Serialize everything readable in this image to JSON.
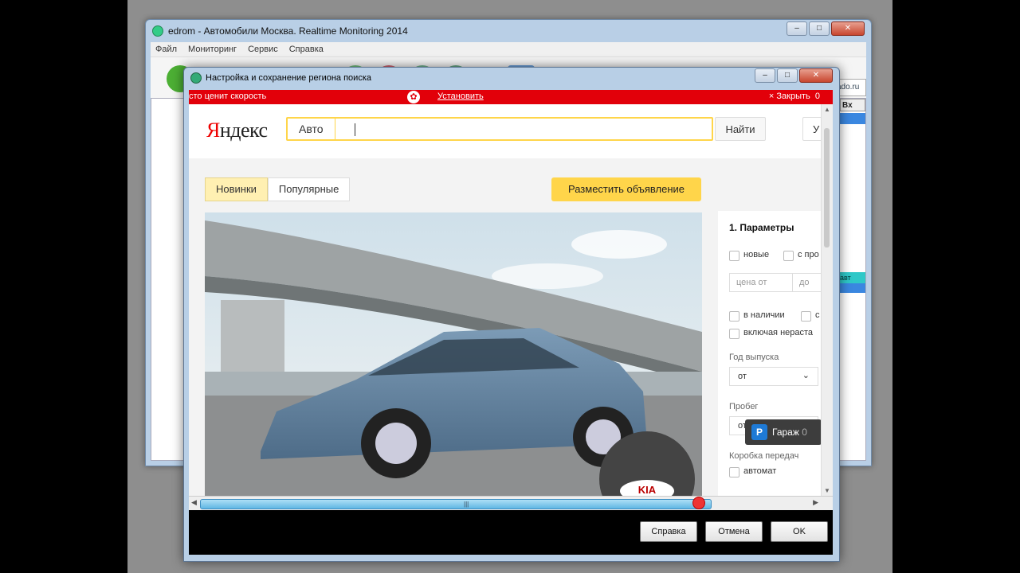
{
  "bg_window": {
    "title": "edrom - Автомобили Москва. Realtime Monitoring 2014",
    "menu": [
      "Файл",
      "Мониторинг",
      "Сервис",
      "Справка"
    ],
    "side_label": "ado.ru",
    "col_label": "Вх",
    "cell_label": "авт"
  },
  "dialog": {
    "title": "Настройка и сохранение региона поиска",
    "buttons": {
      "help": "Справка",
      "cancel": "Отмена",
      "ok": "OK"
    }
  },
  "promo_bar": {
    "text": "сто ценит скорость",
    "install": "Установить",
    "close": "× Закрыть",
    "close_count": "0"
  },
  "yandex": {
    "logo_red": "Я",
    "logo_rest": "ндекс",
    "service": "Авто",
    "search_button": "Найти",
    "cut_button": "У"
  },
  "tabs": [
    {
      "label": "Новинки",
      "active": true
    },
    {
      "label": "Популярные",
      "active": false
    }
  ],
  "post_ad_button": "Разместить объявление",
  "photo": {
    "brand": "KIA"
  },
  "params": {
    "heading": "1. Параметры",
    "new_label": "новые",
    "used_label": "с про",
    "price_from": "цена от",
    "price_to": "до",
    "in_stock": "в наличии",
    "in_stock2": "с",
    "uncleared": "включая нераста",
    "year_label": "Год выпуска",
    "year_value": "от",
    "mileage_label": "Пробег",
    "mileage_value": "от",
    "gearbox_label": "Коробка передач",
    "auto_label": "автомат"
  },
  "garage": {
    "icon": "P",
    "label": "Гараж",
    "count": "0"
  },
  "colors": {
    "yandex_red": "#e2000a",
    "accent_yellow": "#ffd54a",
    "garage_blue": "#1e7ad6"
  }
}
